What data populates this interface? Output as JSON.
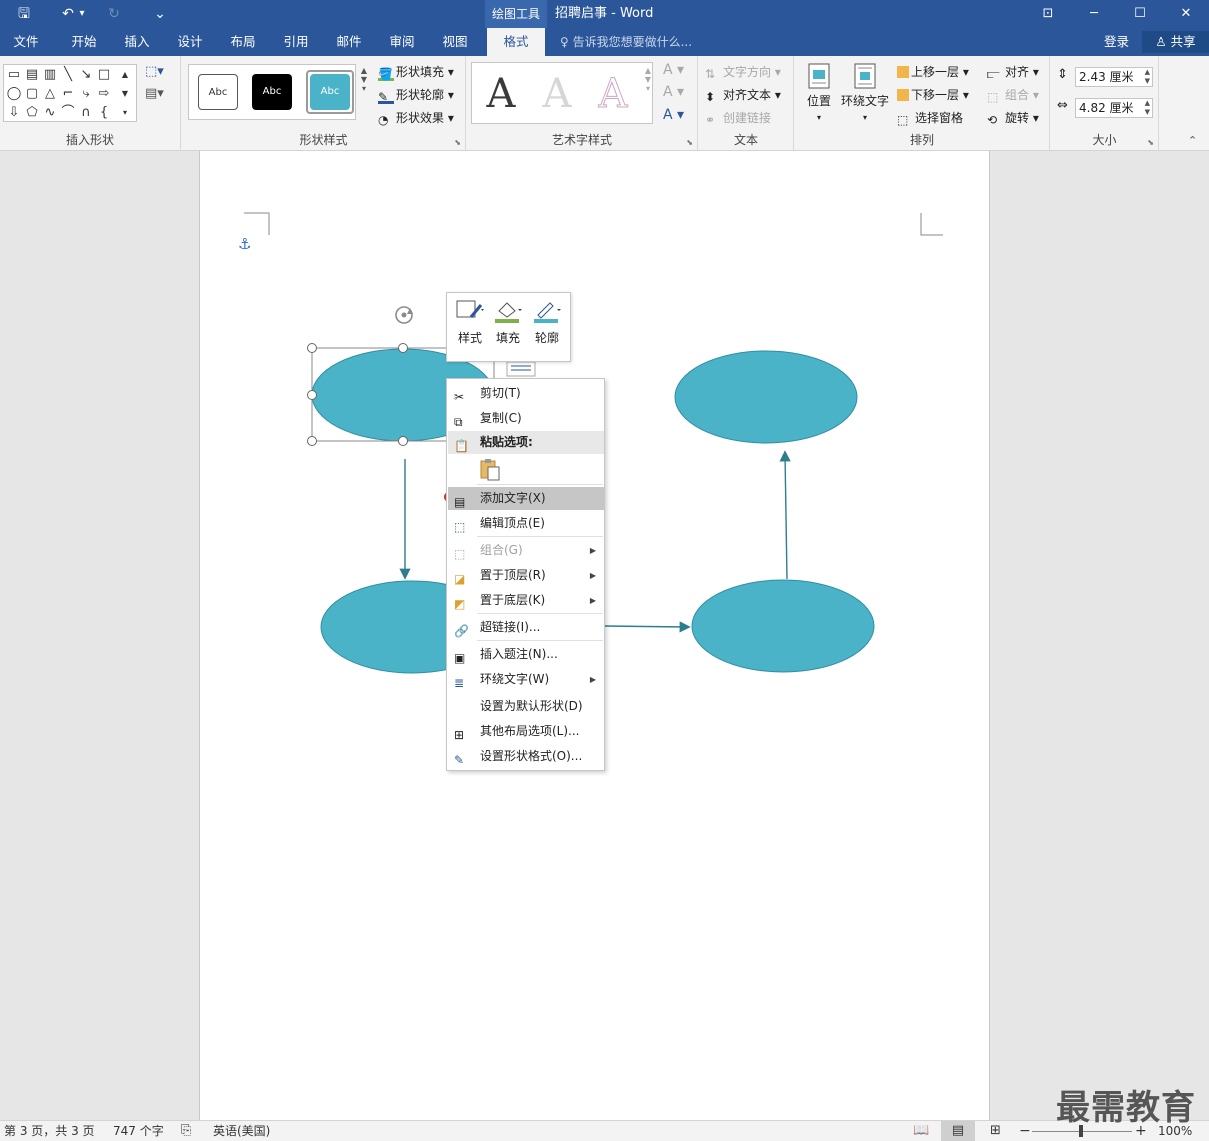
{
  "titlebar": {
    "context_tool": "绘图工具",
    "doc_title": "招聘启事 - Word",
    "qa_save": "🖫",
    "qa_undo": "↶",
    "qa_undo_drop": "▾",
    "qa_redo": "↻",
    "qa_custom": "⌄",
    "win_ribbon_opts": "⊡",
    "win_minimize": "─",
    "win_restore": "☐",
    "win_close": "✕"
  },
  "tabs": [
    "文件",
    "开始",
    "插入",
    "设计",
    "布局",
    "引用",
    "邮件",
    "审阅",
    "视图",
    "格式"
  ],
  "tellme": "♀ 告诉我您想要做什么...",
  "signin": "登录",
  "share": "♙ 共享",
  "ribbon": {
    "groups": {
      "insert_shapes": "插入形状",
      "shape_styles": "形状样式",
      "wordart_styles": "艺术字样式",
      "text": "文本",
      "arrange": "排列",
      "size": "大小"
    },
    "style_samples": [
      "Abc",
      "Abc",
      "Abc"
    ],
    "shape_fill": "形状填充",
    "shape_outline": "形状轮廓",
    "shape_effects": "形状效果",
    "wordart_letter": "A",
    "text_direction": "文字方向",
    "align_text": "对齐文本",
    "create_link": "创建链接",
    "position": "位置",
    "wrap_text": "环绕文字",
    "bring_forward": "上移一层",
    "send_backward": "下移一层",
    "selection_pane": "选择窗格",
    "align": "对齐",
    "group": "组合",
    "rotate": "旋转",
    "height": "2.43 厘米",
    "width": "4.82 厘米"
  },
  "minitoolbar": {
    "style": "样式",
    "fill": "填充",
    "outline": "轮廓"
  },
  "context_menu": {
    "cut": "剪切(T)",
    "copy": "复制(C)",
    "paste_options": "粘贴选项:",
    "add_text": "添加文字(X)",
    "edit_points": "编辑顶点(E)",
    "group": "组合(G)",
    "bring_to_front": "置于顶层(R)",
    "send_to_back": "置于底层(K)",
    "hyperlink": "超链接(I)...",
    "insert_caption": "插入题注(N)...",
    "wrap_text": "环绕文字(W)",
    "set_default": "设置为默认形状(D)",
    "more_layout": "其他布局选项(L)...",
    "format_shape": "设置形状格式(O)..."
  },
  "statusbar": {
    "page": "第 3 页，共 3 页",
    "words": "747 个字",
    "language": "英语(美国)",
    "zoom": "100%",
    "zoom_minus": "−",
    "zoom_plus": "+"
  },
  "watermark": "最需教育",
  "colors": {
    "accent": "#2b579a",
    "shape_fill": "#4bb3c8",
    "shape_stroke": "#2f8ea3",
    "connector": "#2e7d8c",
    "highlight_ring": "#e03030"
  }
}
